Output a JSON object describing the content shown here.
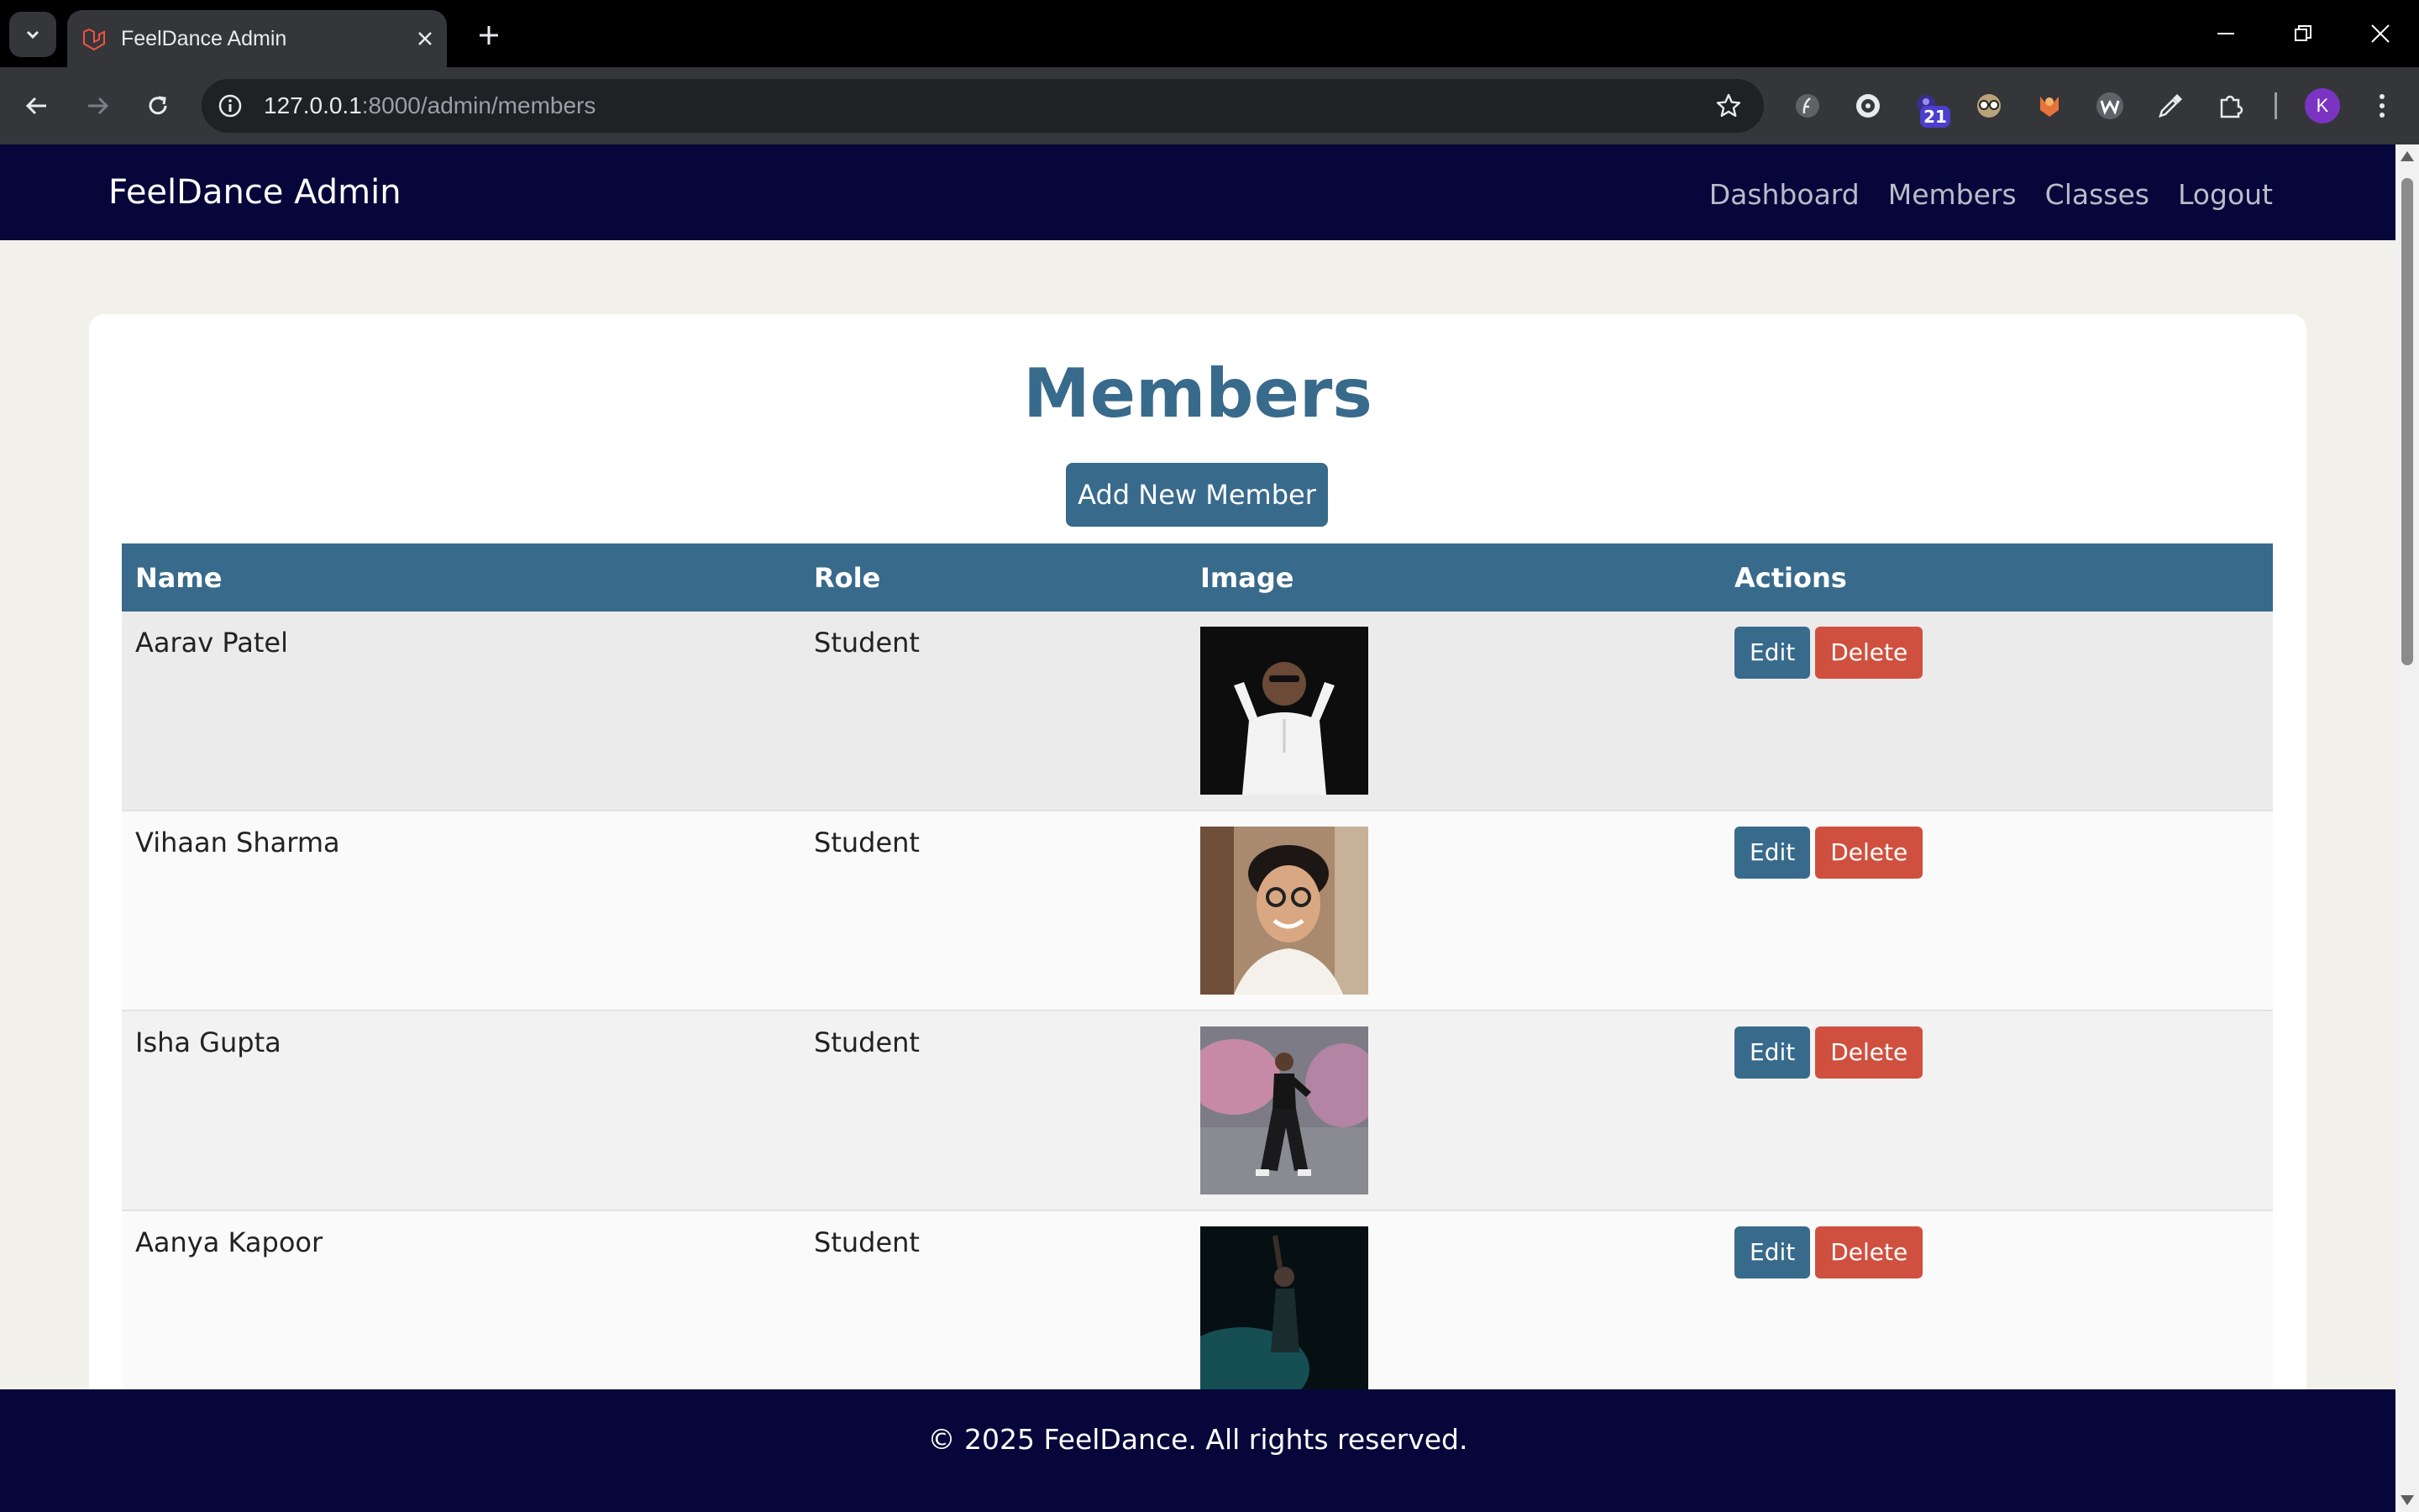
{
  "browser": {
    "tab_title": "FeelDance Admin",
    "url_host": "127.0.0.1",
    "url_rest": ":8000/admin/members",
    "extension_badge": "21",
    "profile_initial": "K"
  },
  "site": {
    "brand": "FeelDance Admin",
    "nav": [
      "Dashboard",
      "Members",
      "Classes",
      "Logout"
    ],
    "page_title": "Members",
    "add_button": "Add New Member",
    "footer": "© 2025 FeelDance. All rights reserved."
  },
  "table": {
    "headers": [
      "Name",
      "Role",
      "Image",
      "Actions"
    ],
    "rows": [
      {
        "name": "Aarav Patel",
        "role": "Student",
        "image": "photo-man-white-hoodie-dark-background"
      },
      {
        "name": "Vihaan Sharma",
        "role": "Student",
        "image": "photo-smiling-man-glasses"
      },
      {
        "name": "Isha Gupta",
        "role": "Student",
        "image": "photo-woman-dancing-street"
      },
      {
        "name": "Aanya Kapoor",
        "role": "Student",
        "image": "photo-dancer-stage-teal-light"
      }
    ],
    "edit_label": "Edit",
    "delete_label": "Delete"
  },
  "colors": {
    "header_bg": "#06063a",
    "accent": "#386a8c",
    "danger": "#d0503f",
    "page_bg": "#f1f0ea"
  }
}
